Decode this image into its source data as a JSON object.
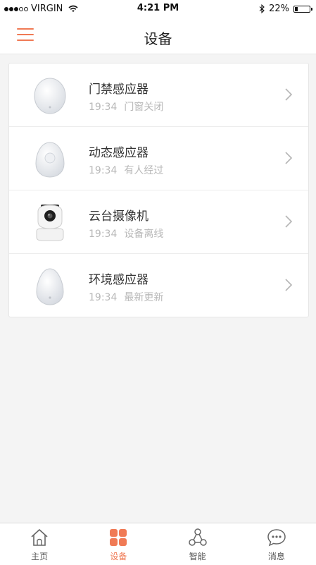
{
  "status_bar": {
    "carrier": "VIRGIN",
    "time": "4:21 PM",
    "battery": "22%",
    "battery_level": 0.22,
    "signal_bars_filled": 3,
    "signal_bars_total": 5
  },
  "nav": {
    "title": "设备",
    "menu_icon": "hamburger-menu-icon"
  },
  "devices": [
    {
      "name": "门禁感应器",
      "time": "19:34",
      "status": "门窗关闭",
      "icon": "door-sensor-icon"
    },
    {
      "name": "动态感应器",
      "time": "19:34",
      "status": "有人经过",
      "icon": "motion-sensor-icon"
    },
    {
      "name": "云台摄像机",
      "time": "19:34",
      "status": "设备离线",
      "icon": "camera-icon"
    },
    {
      "name": "环境感应器",
      "time": "19:34",
      "status": "最新更新",
      "icon": "environment-sensor-icon"
    }
  ],
  "tabs": [
    {
      "label": "主页",
      "icon": "home-icon",
      "active": false
    },
    {
      "label": "设备",
      "icon": "devices-grid-icon",
      "active": true
    },
    {
      "label": "智能",
      "icon": "smart-nodes-icon",
      "active": false
    },
    {
      "label": "消息",
      "icon": "message-bubble-icon",
      "active": false
    }
  ],
  "colors": {
    "accent": "#f07a55",
    "background": "#f4f4f4",
    "secondary_text": "#b8b8b8"
  }
}
